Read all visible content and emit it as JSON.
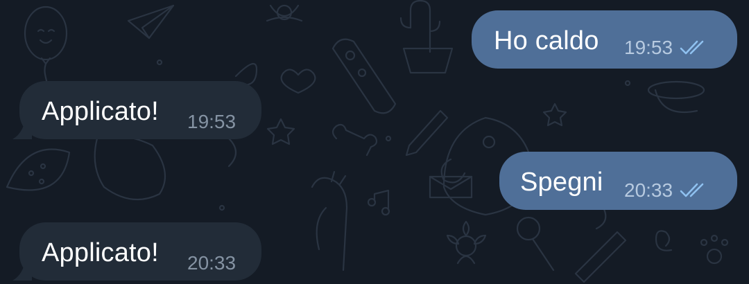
{
  "colors": {
    "outgoing_bubble": "#4f6f98",
    "incoming_bubble": "#222c38",
    "background": "#141b25",
    "check_color": "#8fc1f0"
  },
  "messages": [
    {
      "direction": "outgoing",
      "text": "Ho caldo",
      "time": "19:53",
      "status_icon": "double-check-icon"
    },
    {
      "direction": "incoming",
      "text": "Applicato!",
      "time": "19:53"
    },
    {
      "direction": "outgoing",
      "text": "Spegni",
      "time": "20:33",
      "status_icon": "double-check-icon"
    },
    {
      "direction": "incoming",
      "text": "Applicato!",
      "time": "20:33"
    }
  ]
}
